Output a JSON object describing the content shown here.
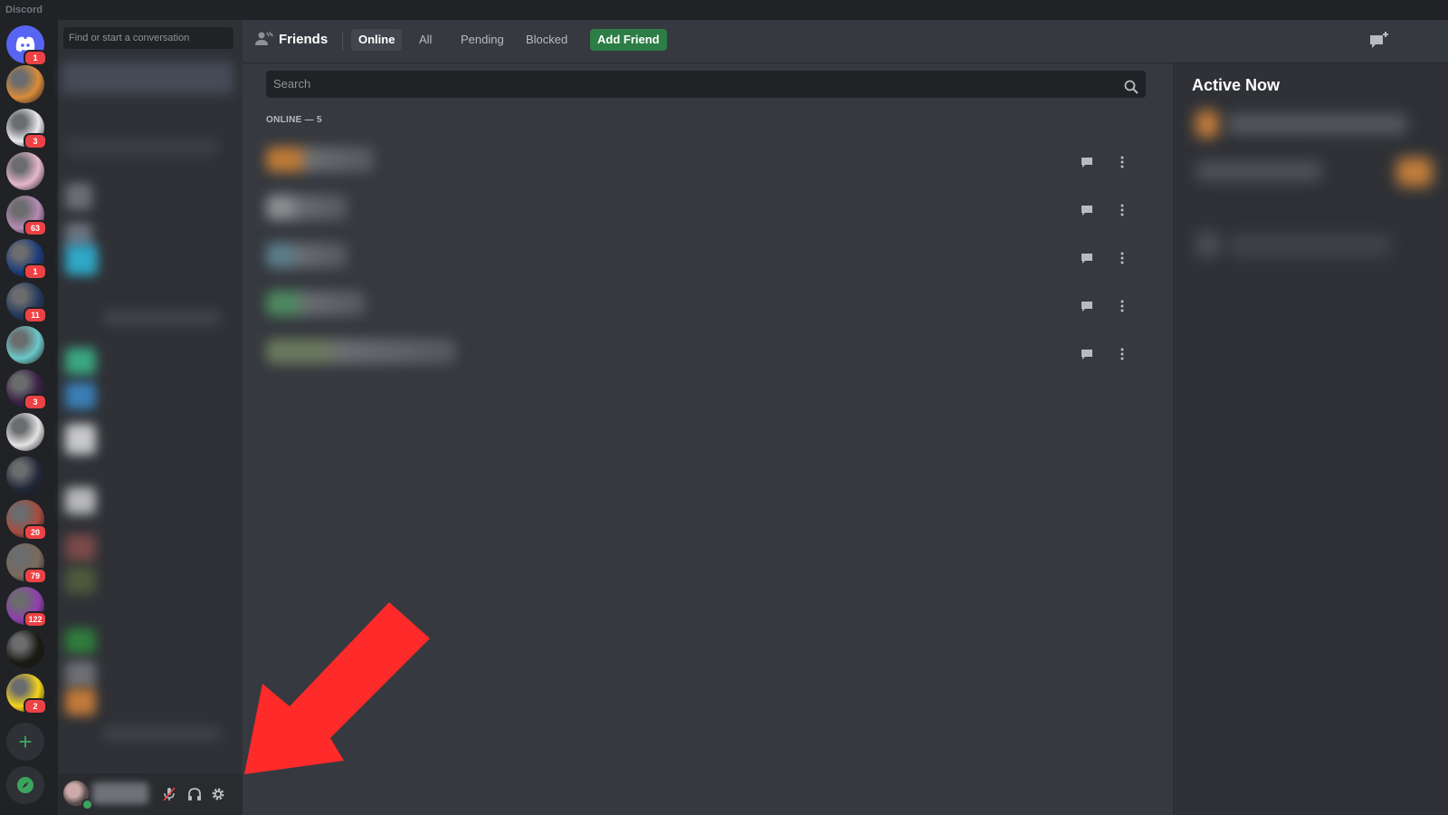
{
  "app": {
    "title": "Discord"
  },
  "servers": [
    {
      "name": "home",
      "badge": "1",
      "color": "#5865f2"
    },
    {
      "name": "server-2",
      "badge": "",
      "color": "#d98c3b"
    },
    {
      "name": "server-3",
      "badge": "3",
      "color": "#e9e9ee"
    },
    {
      "name": "server-4",
      "badge": "",
      "color": "#e6b8c9"
    },
    {
      "name": "server-5",
      "badge": "63",
      "color": "#b58ab3"
    },
    {
      "name": "server-6",
      "badge": "1",
      "color": "#1d3c7a"
    },
    {
      "name": "server-7",
      "badge": "11",
      "color": "#243a5c"
    },
    {
      "name": "server-8",
      "badge": "",
      "color": "#6cc7c8"
    },
    {
      "name": "server-9",
      "badge": "3",
      "color": "#3a2145"
    },
    {
      "name": "server-10",
      "badge": "",
      "color": "#e4e4e4"
    },
    {
      "name": "server-11",
      "badge": "",
      "color": "#24293a"
    },
    {
      "name": "server-12",
      "badge": "20",
      "color": "#a74b3f"
    },
    {
      "name": "server-13",
      "badge": "79",
      "color": "#7a6a5a"
    },
    {
      "name": "server-14",
      "badge": "122",
      "color": "#8f3fae"
    },
    {
      "name": "server-15",
      "badge": "",
      "color": "#1b1b12"
    },
    {
      "name": "server-16",
      "badge": "2",
      "color": "#f5d319"
    }
  ],
  "dm": {
    "search_placeholder": "Find or start a conversation"
  },
  "header": {
    "title": "Friends",
    "tabs": [
      "Online",
      "All",
      "Pending",
      "Blocked"
    ],
    "add_friend": "Add Friend"
  },
  "friends": {
    "search_placeholder": "Search",
    "online_label": "ONLINE — 5",
    "rows": [
      {
        "color": "#c07a35"
      },
      {
        "color": "#8b8f92"
      },
      {
        "color": "#5c7f8c"
      },
      {
        "color": "#4e8a60"
      },
      {
        "color": "#6a7a5e"
      }
    ]
  },
  "active_now": {
    "title": "Active Now"
  },
  "colors": {
    "accent": "#5865f2",
    "add_friend_green": "#2d7d46",
    "badge_red": "#ed4245",
    "annotation_arrow": "#ff2a2a"
  }
}
